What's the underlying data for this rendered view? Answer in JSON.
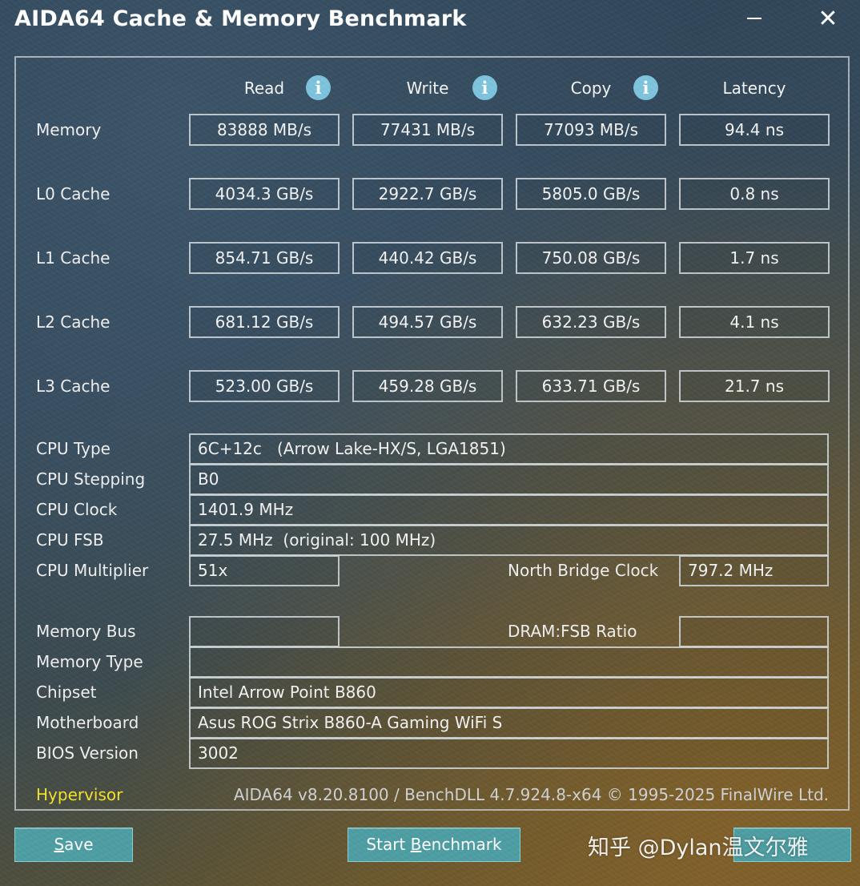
{
  "window": {
    "title": "AIDA64 Cache & Memory Benchmark",
    "close_glyph": "✕"
  },
  "columns": {
    "read": "Read",
    "write": "Write",
    "copy": "Copy",
    "latency": "Latency",
    "info_glyph": "i"
  },
  "rows": [
    {
      "label": "Memory",
      "read": "83888 MB/s",
      "write": "77431 MB/s",
      "copy": "77093 MB/s",
      "latency": "94.4 ns"
    },
    {
      "label": "L0 Cache",
      "read": "4034.3 GB/s",
      "write": "2922.7 GB/s",
      "copy": "5805.0 GB/s",
      "latency": "0.8 ns"
    },
    {
      "label": "L1 Cache",
      "read": "854.71 GB/s",
      "write": "440.42 GB/s",
      "copy": "750.08 GB/s",
      "latency": "1.7 ns"
    },
    {
      "label": "L2 Cache",
      "read": "681.12 GB/s",
      "write": "494.57 GB/s",
      "copy": "632.23 GB/s",
      "latency": "4.1 ns"
    },
    {
      "label": "L3 Cache",
      "read": "523.00 GB/s",
      "write": "459.28 GB/s",
      "copy": "633.71 GB/s",
      "latency": "21.7 ns"
    }
  ],
  "cpu": {
    "type_label": "CPU Type",
    "type_value": "6C+12c   (Arrow Lake-HX/S, LGA1851)",
    "stepping_label": "CPU Stepping",
    "stepping_value": "B0",
    "clock_label": "CPU Clock",
    "clock_value": "1401.9 MHz",
    "fsb_label": "CPU FSB",
    "fsb_value": "27.5 MHz  (original: 100 MHz)",
    "multiplier_label": "CPU Multiplier",
    "multiplier_value": "51x",
    "nb_clock_label": "North Bridge Clock",
    "nb_clock_value": "797.2 MHz"
  },
  "system": {
    "memory_bus_label": "Memory Bus",
    "memory_bus_value": "",
    "dram_ratio_label": "DRAM:FSB Ratio",
    "dram_ratio_value": "",
    "memory_type_label": "Memory Type",
    "memory_type_value": "",
    "chipset_label": "Chipset",
    "chipset_value": "Intel Arrow Point B860",
    "motherboard_label": "Motherboard",
    "motherboard_value": "Asus ROG Strix B860-A Gaming WiFi S",
    "bios_label": "BIOS Version",
    "bios_value": "3002"
  },
  "footer": {
    "hypervisor": "Hypervisor",
    "version": "AIDA64 v8.20.8100 / BenchDLL 4.7.924.8-x64 © 1995-2025 FinalWire Ltd."
  },
  "buttons": {
    "save_first": "S",
    "save_rest": "ave",
    "start_pre": "Start ",
    "start_underline": "B",
    "start_rest": "enchmark"
  },
  "watermark": "知乎 @Dylan温文尔雅",
  "colors": {
    "hypervisor": "#f3e22b",
    "button": "#4d9ea3",
    "info_icon": "#7ec4de"
  }
}
